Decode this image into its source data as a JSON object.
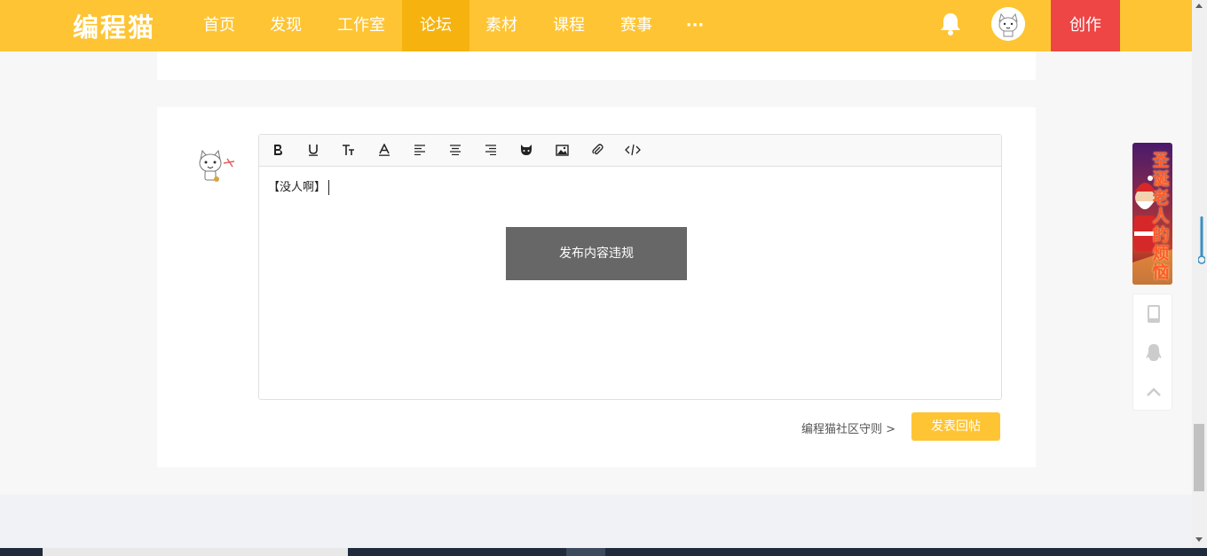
{
  "brand": {
    "logo": "编程猫"
  },
  "nav": {
    "items": [
      {
        "label": "首页",
        "active": false
      },
      {
        "label": "发现",
        "active": false
      },
      {
        "label": "工作室",
        "active": false
      },
      {
        "label": "论坛",
        "active": true
      },
      {
        "label": "素材",
        "active": false
      },
      {
        "label": "课程",
        "active": false
      },
      {
        "label": "赛事",
        "active": false
      },
      {
        "label": "···",
        "active": false
      }
    ],
    "create_label": "创作"
  },
  "editor": {
    "toolbar": [
      "bold",
      "underline",
      "font-size",
      "font-color",
      "align-left",
      "align-center",
      "align-right",
      "emoji-cat",
      "image",
      "attachment",
      "code"
    ],
    "content": "【没人啊】",
    "toast": "发布内容违规"
  },
  "footer_actions": {
    "guide_link": "编程猫社区守则 >",
    "submit_label": "发表回帖"
  },
  "promo": {
    "text": "圣诞老人的烦恼"
  },
  "colors": {
    "brand_yellow": "#fec433",
    "active_nav": "#f6b310",
    "create_red": "#ee4545",
    "toast_bg": "#676767"
  }
}
